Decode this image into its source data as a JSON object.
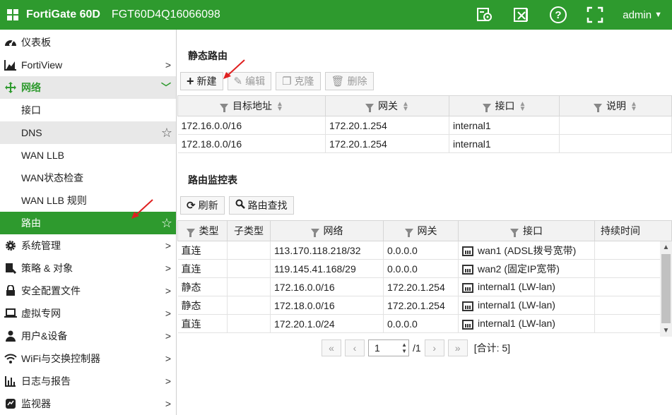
{
  "header": {
    "product": "FortiGate 60D",
    "serial": "FGT60D4Q16066098",
    "user": "admin",
    "icons": [
      "cli-console-icon",
      "fullscreen-toggle-icon",
      "help-icon",
      "expand-icon"
    ]
  },
  "sidebar": {
    "items": [
      {
        "label": "仪表板",
        "icon": "dashboard-icon"
      },
      {
        "label": "FortiView",
        "icon": "chart-icon"
      },
      {
        "label": "网络",
        "icon": "network-icon"
      },
      {
        "label": "接口"
      },
      {
        "label": "DNS"
      },
      {
        "label": "WAN LLB"
      },
      {
        "label": "WAN状态检查"
      },
      {
        "label": "WAN LLB 规则"
      },
      {
        "label": "路由"
      },
      {
        "label": "系统管理",
        "icon": "gear-icon"
      },
      {
        "label": "策略 & 对象",
        "icon": "policy-icon"
      },
      {
        "label": "安全配置文件",
        "icon": "lock-icon"
      },
      {
        "label": "虚拟专网",
        "icon": "laptop-icon"
      },
      {
        "label": "用户&设备",
        "icon": "user-icon"
      },
      {
        "label": "WiFi与交换控制器",
        "icon": "wifi-icon"
      },
      {
        "label": "日志与报告",
        "icon": "report-icon"
      },
      {
        "label": "监视器",
        "icon": "monitor-icon"
      }
    ]
  },
  "static_routes": {
    "title": "静态路由",
    "buttons": {
      "new": "新建",
      "edit": "编辑",
      "clone": "克隆",
      "delete": "删除"
    },
    "columns": [
      "目标地址",
      "网关",
      "接口",
      "说明"
    ],
    "rows": [
      [
        "172.16.0.0/16",
        "172.20.1.254",
        "internal1",
        ""
      ],
      [
        "172.18.0.0/16",
        "172.20.1.254",
        "internal1",
        ""
      ]
    ]
  },
  "route_monitor": {
    "title": "路由监控表",
    "buttons": {
      "refresh": "刷新",
      "lookup": "路由查找"
    },
    "columns": [
      "类型",
      "子类型",
      "网络",
      "网关",
      "接口",
      "持续时间"
    ],
    "rows": [
      [
        "直连",
        "",
        "113.170.118.218/32",
        "0.0.0.0",
        "wan1 (ADSL拨号宽带)",
        ""
      ],
      [
        "直连",
        "",
        "119.145.41.168/29",
        "0.0.0.0",
        "wan2 (固定IP宽带)",
        ""
      ],
      [
        "静态",
        "",
        "172.16.0.0/16",
        "172.20.1.254",
        "internal1 (LW-lan)",
        ""
      ],
      [
        "静态",
        "",
        "172.18.0.0/16",
        "172.20.1.254",
        "internal1 (LW-lan)",
        ""
      ],
      [
        "直连",
        "",
        "172.20.1.0/24",
        "0.0.0.0",
        "internal1 (LW-lan)",
        ""
      ]
    ],
    "pager": {
      "page": "1",
      "total_pages": "/1",
      "total": "[合计: 5]"
    }
  },
  "colors": {
    "brand": "#2e9a2e",
    "annotation_arrow": "#e02020"
  }
}
